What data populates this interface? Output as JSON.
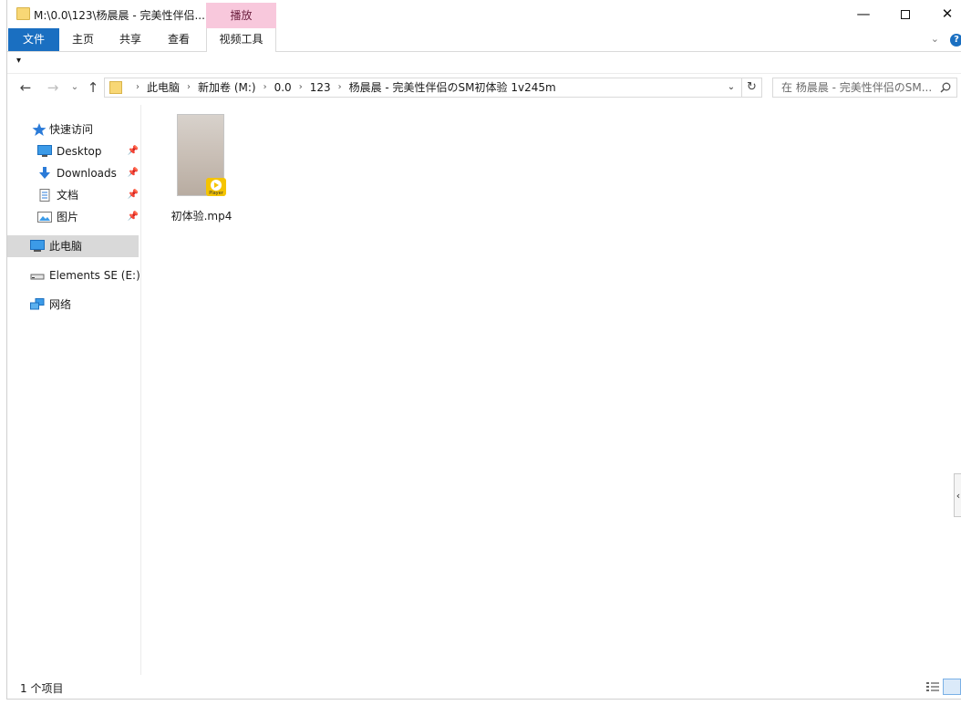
{
  "window": {
    "title": "M:\\0.0\\123\\杨晨晨 - 完美性伴侣...",
    "context_tab": "播放",
    "controls": {
      "minimize": "—",
      "close": "✕"
    }
  },
  "ribbon": {
    "tabs": [
      {
        "label": "文件"
      },
      {
        "label": "主页"
      },
      {
        "label": "共享"
      },
      {
        "label": "查看"
      },
      {
        "label": "视频工具"
      }
    ],
    "expand_glyph": "⌄",
    "help_glyph": "?"
  },
  "qat": {
    "customize_glyph": "▾"
  },
  "nav": {
    "back": "←",
    "forward": "→",
    "recent": "⌄",
    "up": "↑",
    "breadcrumbs": [
      "此电脑",
      "新加卷 (M:)",
      "0.0",
      "123",
      "杨晨晨 - 完美性伴侣のSM初体验 1v245m"
    ],
    "crumb_separator": "›",
    "dropdown": "⌄",
    "refresh": "↻",
    "search_placeholder": "在 杨晨晨 - 完美性伴侣のSM..."
  },
  "sidebar": {
    "items": [
      {
        "label": "快速访问",
        "icon": "star-icon",
        "pinned": false
      },
      {
        "label": "Desktop",
        "icon": "desktop-icon",
        "pinned": true
      },
      {
        "label": "Downloads",
        "icon": "download-icon",
        "pinned": true
      },
      {
        "label": "文档",
        "icon": "document-icon",
        "pinned": true
      },
      {
        "label": "图片",
        "icon": "pictures-icon",
        "pinned": true
      },
      {
        "label": "此电脑",
        "icon": "computer-icon",
        "selected": true
      },
      {
        "label": "Elements SE (E:)",
        "icon": "drive-icon"
      },
      {
        "label": "网络",
        "icon": "network-icon"
      }
    ],
    "pin_glyph": "📌"
  },
  "files": [
    {
      "name": "初体验.mp4",
      "type": "video",
      "badge": "Player"
    }
  ],
  "thumbnail_note": "",
  "statusbar": {
    "item_count": "1 个项目"
  },
  "side_toggle": "‹",
  "colors": {
    "accent": "#1a6fc1",
    "context_tab": "#f8c8dc",
    "folder": "#f8d775",
    "selected": "#d9d9d9"
  }
}
